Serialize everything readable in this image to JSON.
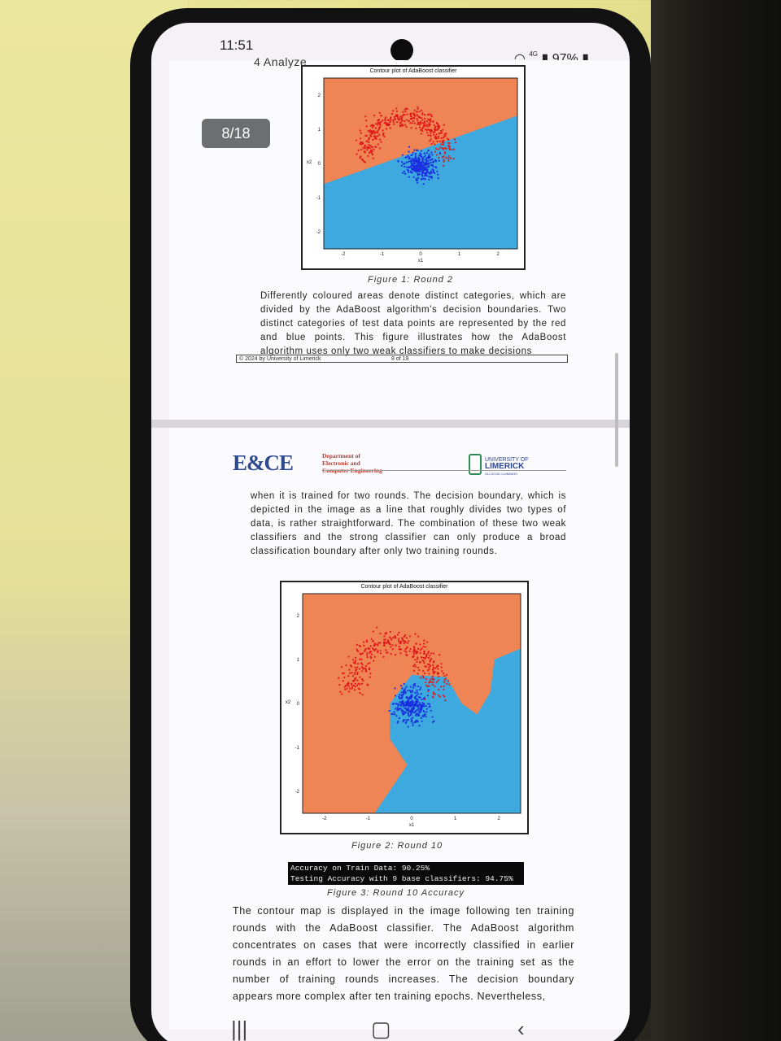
{
  "status_bar": {
    "time": "11:51",
    "network": "4G",
    "battery": "97%"
  },
  "viewer": {
    "section_title": "4  Analyze",
    "page_indicator": "8/18"
  },
  "page1": {
    "figure": {
      "title": "Contour plot of AdaBoost classifier",
      "xlabel": "x1",
      "ylabel": "x2",
      "x_ticks": [
        "-2",
        "-1",
        "0",
        "1",
        "2"
      ],
      "y_ticks": [
        "2",
        "1",
        "0",
        "-1",
        "-2"
      ],
      "caption": "Figure 1: Round 2"
    },
    "paragraph": "Differently coloured areas denote distinct categories, which are divided by the AdaBoost algorithm's decision boundaries. Two distinct categories of test data points are represented by the red and blue points. This figure illustrates how the AdaBoost algorithm uses only two weak classifiers to make decisions",
    "footer": {
      "copyright": "© 2024 by University of Limerick",
      "page": "8 of 19"
    }
  },
  "page2": {
    "header": {
      "logo_left": "E&CE",
      "dept_line1": "Department of",
      "dept_line2": "Electronic and",
      "dept_line3": "Computer Engineering",
      "logo_right_top": "UNIVERSITY OF",
      "logo_right_main": "LIMERICK",
      "logo_right_sub": "OLLSCOIL LUIMNIGH"
    },
    "paragraph1": "when it is trained for two rounds. The decision boundary, which is depicted in the image as a line that roughly divides two types of data, is rather straightforward. The combination of these two weak classifiers and the strong classifier can only produce a broad classification boundary after only two training rounds.",
    "figure": {
      "title": "Contour plot of AdaBoost classifier",
      "xlabel": "x1",
      "ylabel": "x2",
      "x_ticks": [
        "-2",
        "-1",
        "0",
        "1",
        "2"
      ],
      "y_ticks": [
        "2",
        "1",
        "0",
        "-1",
        "-2"
      ],
      "caption": "Figure 2: Round 10"
    },
    "accuracy_output": {
      "line1": "Accuracy on Train Data: 90.25%",
      "line2": "Testing Accuracy with 9 base classifiers: 94.75%",
      "caption": "Figure 3: Round 10 Accuracy"
    },
    "paragraph2": "The contour map is displayed in the image following ten training rounds with the AdaBoost classifier. The AdaBoost algorithm concentrates on cases that were incorrectly classified in earlier rounds in an effort to lower the error on the training set as the number of training rounds increases. The decision boundary appears more complex after ten training epochs. Nevertheless,"
  },
  "colors": {
    "class_region_red": "#ef8455",
    "class_region_blue": "#3ea9df",
    "points_red": "#e01818",
    "points_blue": "#1b2ee0",
    "ece_blue": "#2e4a8f",
    "ece_red": "#c0392b"
  },
  "navigation": {
    "recents_icon": "recents-icon",
    "home_icon": "home-icon",
    "back_icon": "back-icon"
  }
}
